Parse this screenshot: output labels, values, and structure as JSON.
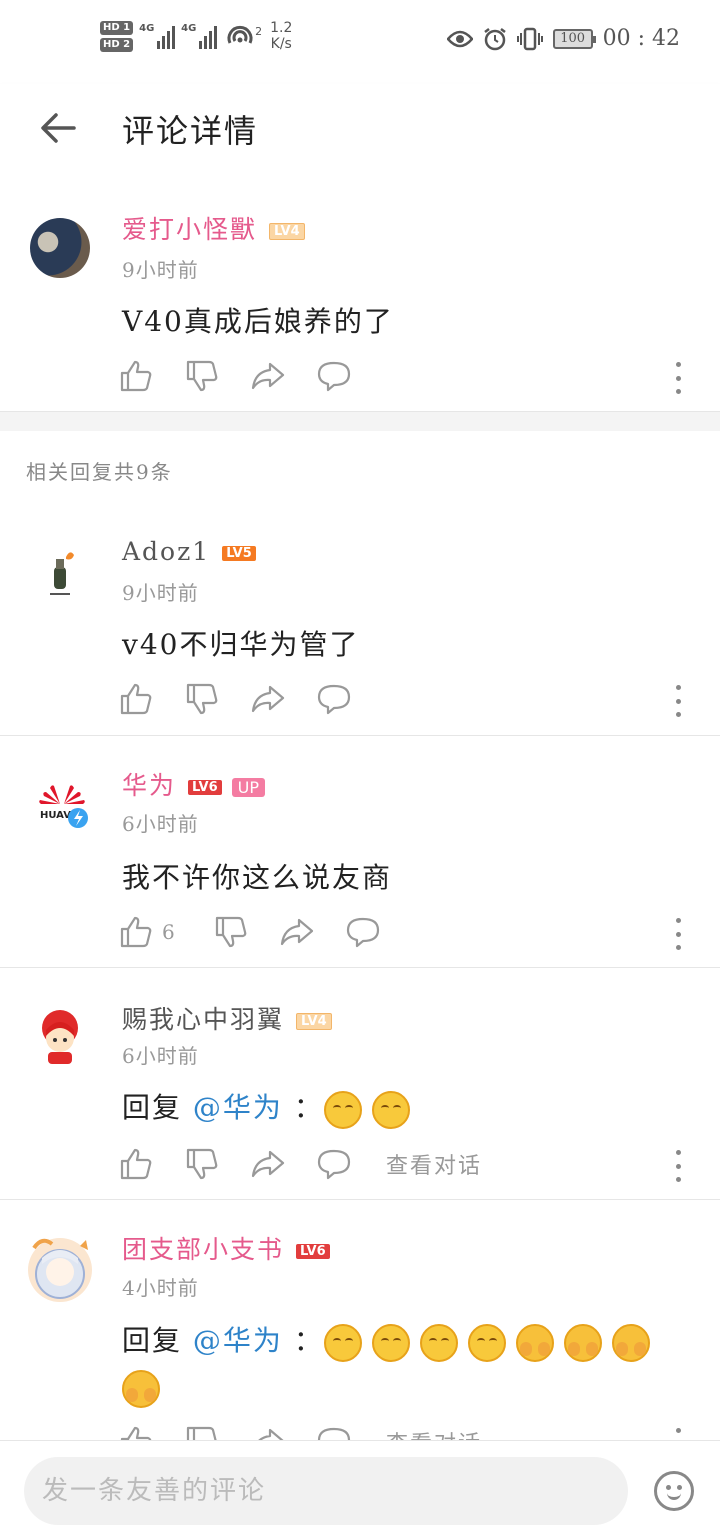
{
  "status_bar": {
    "hd1": "HD 1",
    "hd2": "HD 2",
    "net1": "4G",
    "net2": "4G",
    "speed_value": "1.2",
    "speed_unit": "K/s",
    "hotspot_count": "2",
    "battery": "100",
    "time": "00 : 42"
  },
  "header": {
    "title": "评论详情"
  },
  "main_comment": {
    "username": "爱打小怪獸",
    "level": "LV4",
    "time": "9小时前",
    "text": "V40真成后娘养的了"
  },
  "replies_header": "相关回复共9条",
  "replies": [
    {
      "username": "Adoz1",
      "level": "LV5",
      "time": "9小时前",
      "text": "v40不归华为管了",
      "likes": ""
    },
    {
      "username": "华为",
      "level": "LV6",
      "badge": "UP",
      "time": "6小时前",
      "text": "我不许你这么说友商",
      "likes": "6"
    },
    {
      "username": "赐我心中羽翼",
      "level": "LV4",
      "time": "6小时前",
      "text_prefix": "回复",
      "mention": "@华为",
      "text_suffix": "：",
      "view_conversation": "查看对话"
    },
    {
      "username": "团支部小支书",
      "level": "LV6",
      "time": "4小时前",
      "text_prefix": "回复",
      "mention": "@华为",
      "text_suffix": "：",
      "view_conversation": "查看对话"
    }
  ],
  "huawei_logo_text": "HUAV",
  "bottom": {
    "placeholder": "发一条友善的评论"
  },
  "colors": {
    "username_pink": "#e55a8c",
    "mention_blue": "#2e83c9",
    "lv4": "#fbd6a4",
    "lv5": "#f57a22",
    "lv6": "#e23d3d",
    "up_badge": "#f47ca2"
  },
  "icons": [
    "back-arrow-icon",
    "like-icon",
    "dislike-icon",
    "share-icon",
    "comment-icon",
    "more-icon",
    "emoji-icon",
    "eye-icon",
    "alarm-icon",
    "vibrate-icon",
    "battery-icon"
  ]
}
